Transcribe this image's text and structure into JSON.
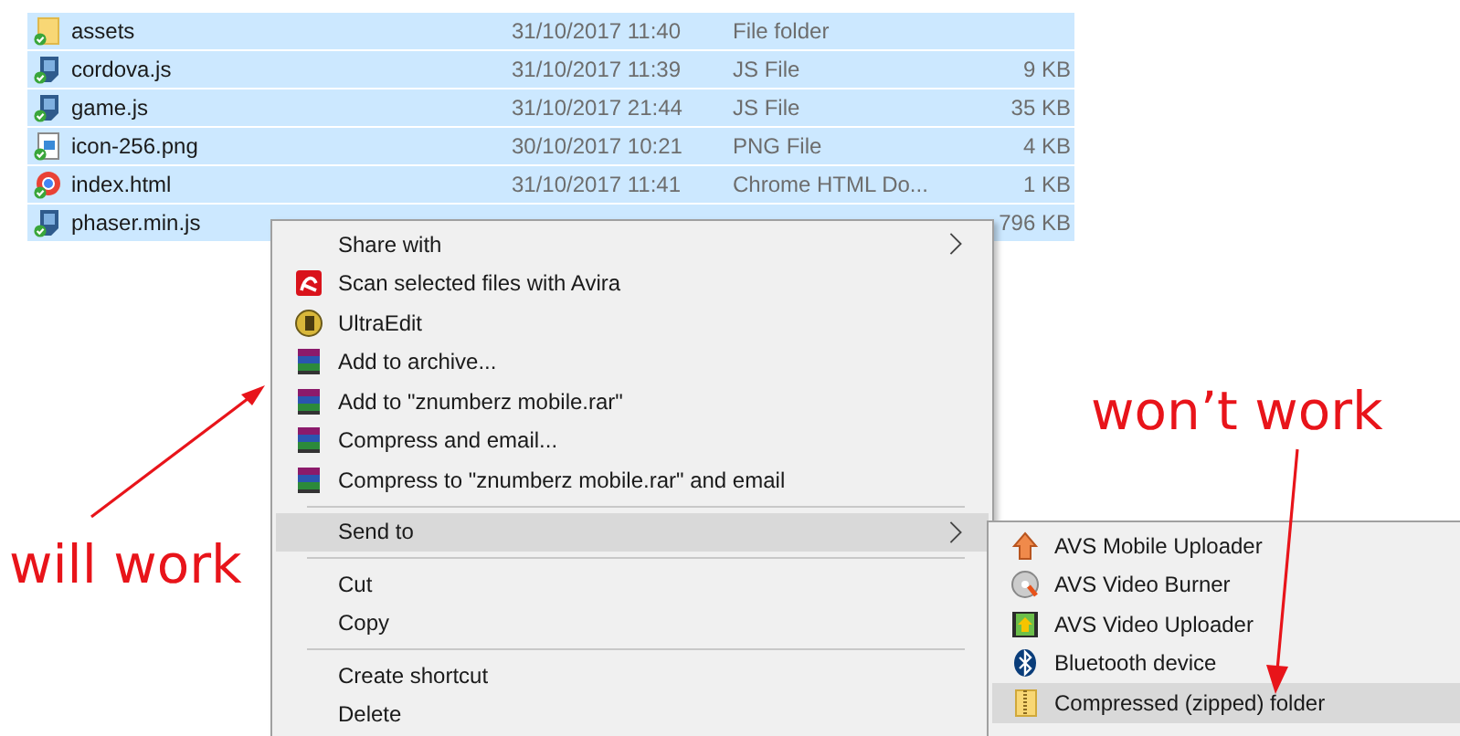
{
  "files": [
    {
      "name": "assets",
      "date": "31/10/2017 11:40",
      "type": "File folder",
      "selected": true
    },
    {
      "name": "cordova.js",
      "date": "31/10/2017 11:39",
      "type": "JS File",
      "size": "9 KB",
      "selected": true
    },
    {
      "name": "game.js",
      "date": "31/10/2017 21:44",
      "type": "JS File",
      "size": "35 KB",
      "selected": true
    },
    {
      "name": "icon-256.png",
      "date": "30/10/2017 10:21",
      "type": "PNG File",
      "size": "4 KB",
      "selected": true
    },
    {
      "name": "index.html",
      "date": "31/10/2017 11:41",
      "type": "Chrome HTML Do...",
      "size": "1 KB",
      "selected": true
    },
    {
      "name": "phaser.min.js",
      "size": "796 KB",
      "selected": true
    }
  ],
  "context_menu": {
    "items": [
      {
        "kind": "item",
        "label": "Share with",
        "submenu": true,
        "selected": false
      },
      {
        "kind": "item",
        "label": "Scan selected files with Avira",
        "submenu": false,
        "selected": false
      },
      {
        "kind": "item",
        "label": "UltraEdit",
        "submenu": false,
        "selected": false
      },
      {
        "kind": "item",
        "label": "Add to archive...",
        "submenu": false,
        "selected": false
      },
      {
        "kind": "item",
        "label": "Add to \"znumberz mobile.rar\"",
        "submenu": false,
        "selected": false
      },
      {
        "kind": "item",
        "label": "Compress and email...",
        "submenu": false,
        "selected": false
      },
      {
        "kind": "item",
        "label": "Compress to \"znumberz mobile.rar\" and email",
        "submenu": false,
        "selected": false
      },
      {
        "kind": "separator"
      },
      {
        "kind": "item",
        "label": "Send to",
        "submenu": true,
        "selected": true
      },
      {
        "kind": "separator"
      },
      {
        "kind": "item",
        "label": "Cut",
        "submenu": false,
        "selected": false
      },
      {
        "kind": "item",
        "label": "Copy",
        "submenu": false,
        "selected": false
      },
      {
        "kind": "separator"
      },
      {
        "kind": "item",
        "label": "Create shortcut",
        "submenu": false,
        "selected": false
      },
      {
        "kind": "item",
        "label": "Delete",
        "submenu": false,
        "selected": false
      }
    ]
  },
  "send_to_menu": {
    "items": [
      {
        "label": "AVS Mobile Uploader",
        "selected": false
      },
      {
        "label": "AVS Video Burner",
        "selected": false
      },
      {
        "label": "AVS Video Uploader",
        "selected": false
      },
      {
        "label": "Bluetooth device",
        "selected": false
      },
      {
        "label": "Compressed (zipped) folder",
        "selected": true
      }
    ]
  },
  "annotations": [
    {
      "text": "will work"
    },
    {
      "text": "won’t work"
    }
  ]
}
